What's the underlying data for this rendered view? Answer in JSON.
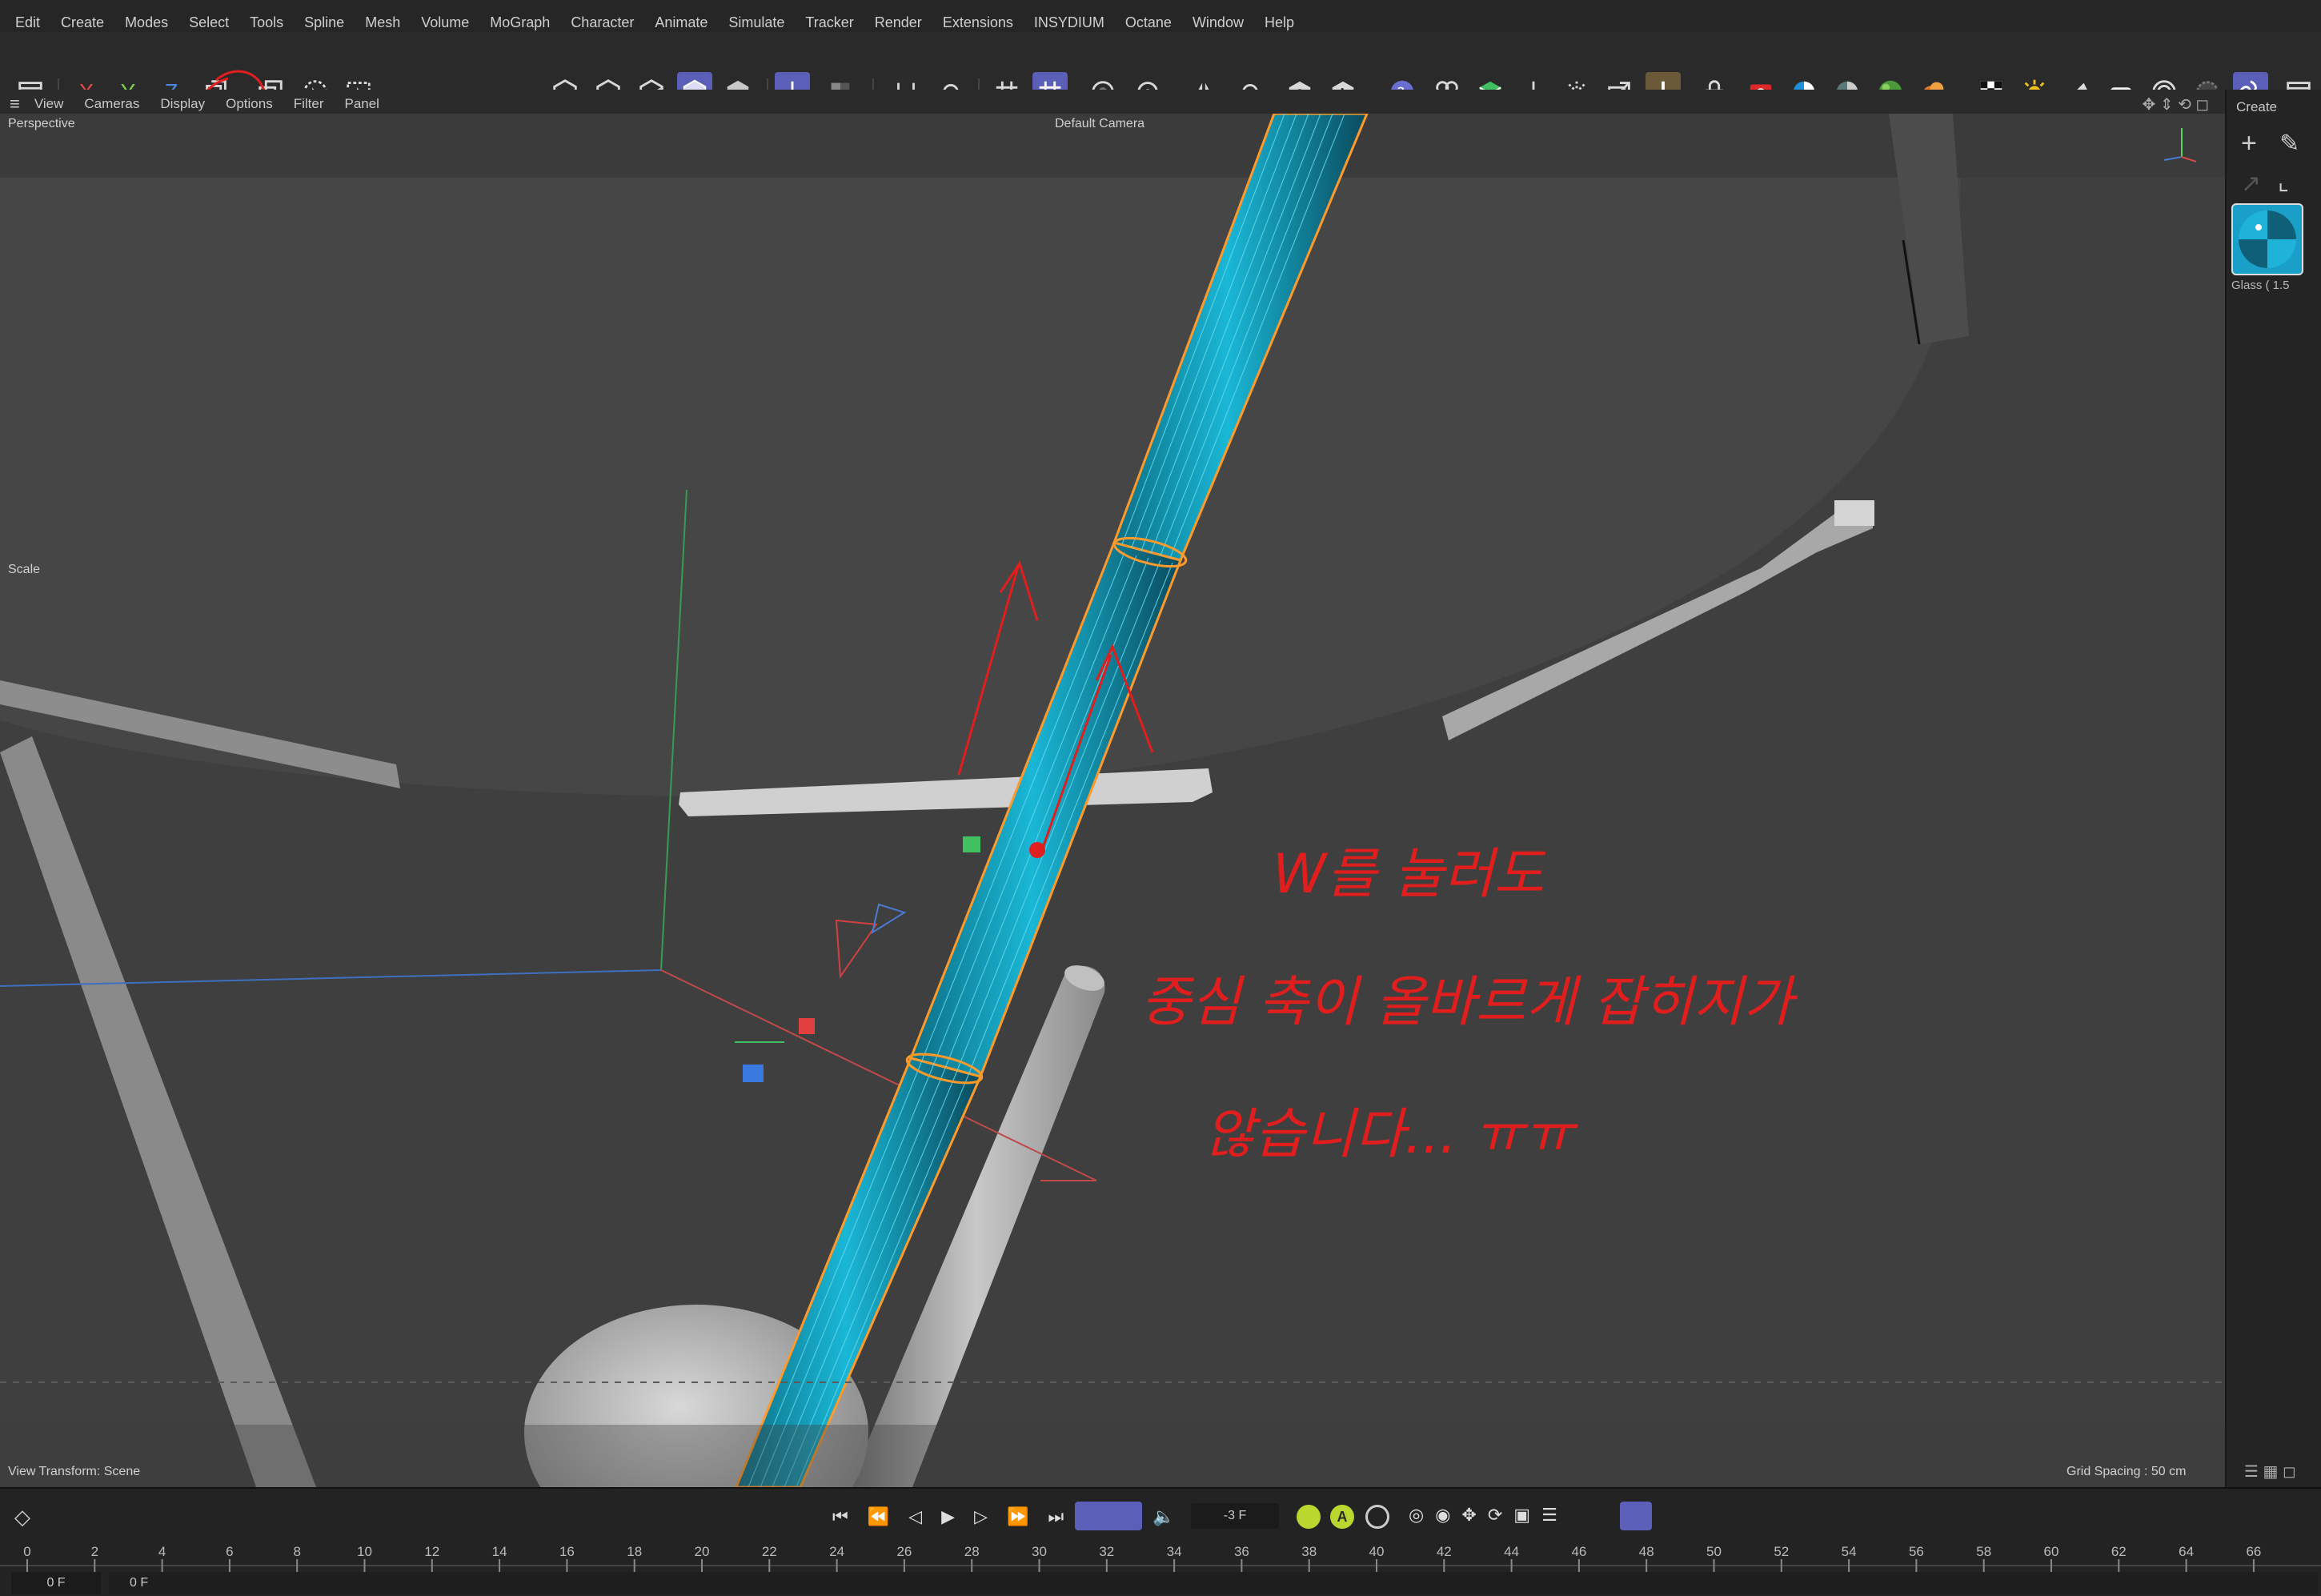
{
  "menu": [
    "Edit",
    "Create",
    "Modes",
    "Select",
    "Tools",
    "Spline",
    "Mesh",
    "Volume",
    "MoGraph",
    "Character",
    "Animate",
    "Simulate",
    "Tracker",
    "Render",
    "Extensions",
    "INSYDIUM",
    "Octane",
    "Window",
    "Help"
  ],
  "axes": {
    "x": "X",
    "y": "Y",
    "z": "Z"
  },
  "view_menu": [
    "View",
    "Cameras",
    "Display",
    "Options",
    "Filter",
    "Panel"
  ],
  "viewport": {
    "mode": "Perspective",
    "camera": "Default Camera",
    "scale_label": "Scale",
    "view_transform": "View Transform: Scene",
    "grid_spacing": "Grid Spacing : 50 cm",
    "annotation": [
      "W를 눌러도",
      "중심 축이 올바르게 잡히지가",
      "않습니다... ㅠㅠ"
    ]
  },
  "right_panel": {
    "create_label": "Create",
    "material_name": "Glass ( 1.5"
  },
  "timeline": {
    "current_frame": "-3 F",
    "start_field": "0 F",
    "end_field": "0 F",
    "ticks": [
      "0",
      "2",
      "4",
      "6",
      "8",
      "10",
      "12",
      "14",
      "16",
      "18",
      "20",
      "22",
      "24",
      "26",
      "28",
      "30",
      "32",
      "34",
      "36",
      "38",
      "40",
      "42",
      "44",
      "46",
      "48",
      "50",
      "52",
      "54",
      "56",
      "58",
      "60",
      "62",
      "64",
      "66"
    ],
    "autokey_label": "A"
  },
  "colors": {
    "accent": "#5b5fb8",
    "annotation": "#e01e1e",
    "cylinder": "#17b6d3",
    "selection": "#ff9a2a"
  }
}
